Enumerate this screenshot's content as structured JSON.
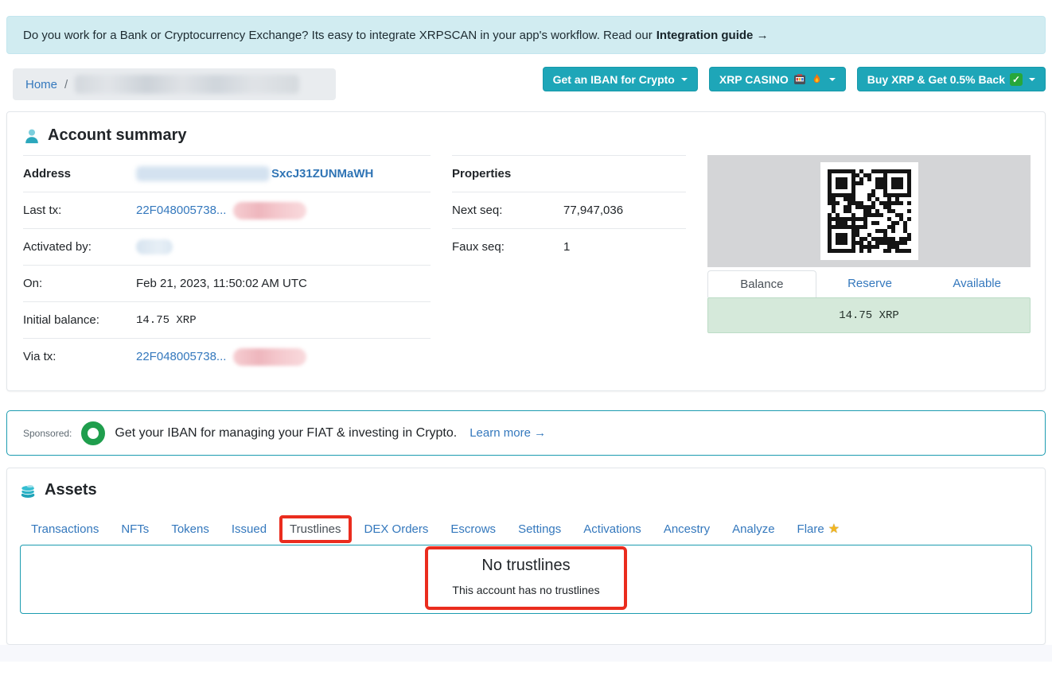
{
  "banner": {
    "text": "Do you work for a Bank or Cryptocurrency Exchange? Its easy to integrate XRPSCAN in your app's workflow. Read our",
    "link_label": "Integration guide →"
  },
  "breadcrumb": {
    "home_label": "Home",
    "separator": "/"
  },
  "header_buttons": {
    "iban": {
      "label": "Get an IBAN for Crypto"
    },
    "casino": {
      "label": "XRP CASINO",
      "icons": [
        "slot-machine",
        "fire"
      ]
    },
    "buy": {
      "label": "Buy XRP & Get 0.5% Back",
      "icons": [
        "check"
      ]
    }
  },
  "account_summary": {
    "title": "Account summary",
    "address": {
      "label": "Address",
      "visible_value": "SxcJ31ZUNMaWH"
    },
    "last_tx": {
      "label": "Last tx:",
      "value": "22F048005738..."
    },
    "activated_by": {
      "label": "Activated by:"
    },
    "activated_on": {
      "label": "On:",
      "value": "Feb 21, 2023, 11:50:02 AM UTC"
    },
    "initial_balance": {
      "label": "Initial balance:",
      "value": "14.75 XRP"
    },
    "via_tx": {
      "label": "Via tx:",
      "value": "22F048005738..."
    },
    "properties": {
      "title": "Properties",
      "next_seq": {
        "label": "Next seq:",
        "value": "77,947,036"
      },
      "faux_seq": {
        "label": "Faux seq:",
        "value": "1"
      }
    },
    "balance_panel": {
      "tabs": [
        "Balance",
        "Reserve",
        "Available"
      ],
      "active_tab": "Balance",
      "value": "14.75 XRP"
    }
  },
  "sponsored": {
    "label": "Sponsored:",
    "text": "Get your IBAN for managing your FIAT & investing in Crypto.",
    "link_label": "Learn more →"
  },
  "assets": {
    "title": "Assets",
    "tabs": [
      "Transactions",
      "NFTs",
      "Tokens",
      "Issued",
      "Trustlines",
      "DEX Orders",
      "Escrows",
      "Settings",
      "Activations",
      "Ancestry",
      "Analyze",
      "Flare"
    ],
    "active_tab": "Trustlines",
    "empty_state": {
      "title": "No trustlines",
      "subtitle": "This account has no trustlines"
    }
  },
  "colors": {
    "accent_teal": "#1ea6b8",
    "link_blue": "#3478bd",
    "annotation_red": "#ea2c1e",
    "banner_bg": "#d1ecf1",
    "balance_bg": "#d5e9da",
    "qr_panel_bg": "#d4d5d7",
    "sponsor_green": "#1f9e4d"
  }
}
